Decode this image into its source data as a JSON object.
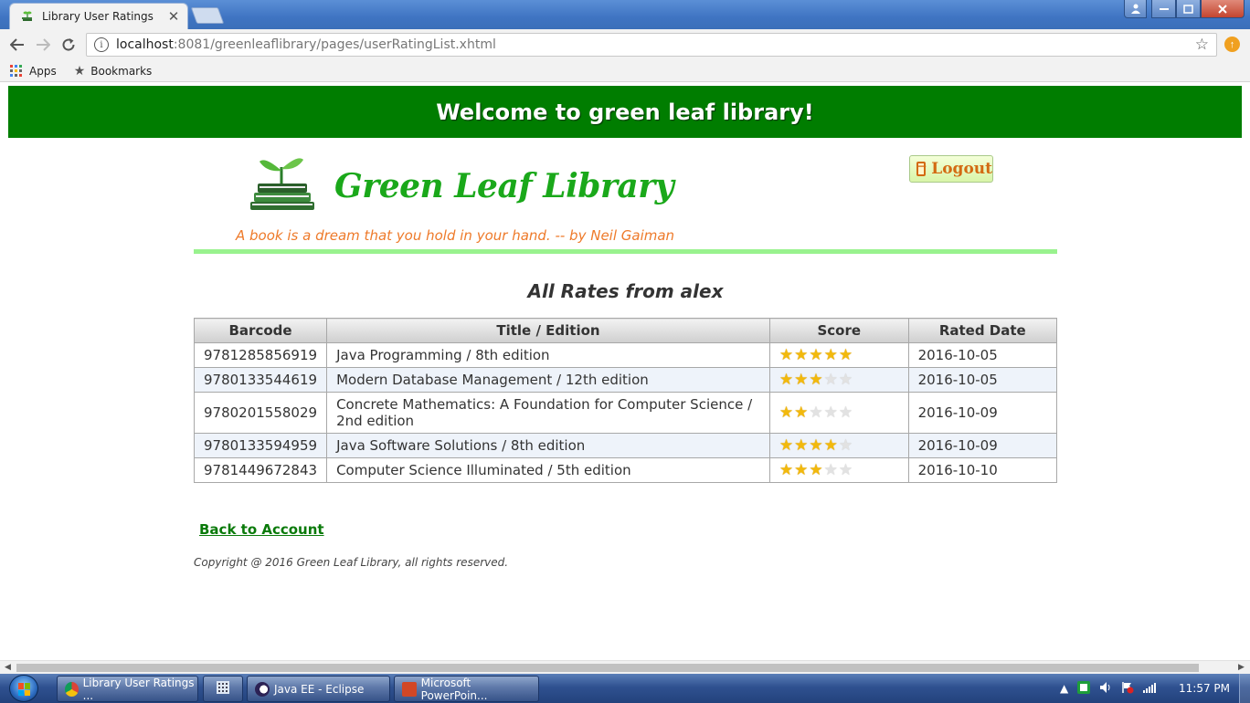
{
  "browser": {
    "tab_title": "Library User Ratings",
    "tab_close": "✕",
    "url_host": "localhost",
    "url_path": ":8081/greenleaflibrary/pages/userRatingList.xhtml",
    "bookmarks": [
      {
        "label": "Apps",
        "icon": "apps-grid-icon"
      },
      {
        "label": "Bookmarks",
        "icon": "star-icon"
      }
    ],
    "nav_icons": [
      "back-arrow-icon",
      "forward-arrow-icon",
      "reload-icon"
    ],
    "window_controls": [
      "user-icon",
      "minimize-icon",
      "maximize-icon",
      "close-icon"
    ]
  },
  "header": {
    "banner": "Welcome to green leaf library!",
    "logo_text": "Green Leaf Library",
    "tagline": "A book is a dream that you hold in your hand. -- by Neil Gaiman",
    "logout_label": "Logout"
  },
  "main": {
    "title": "All Rates from alex",
    "columns": [
      "Barcode",
      "Title / Edition",
      "Score",
      "Rated Date"
    ],
    "rows": [
      {
        "barcode": "9781285856919",
        "title": "Java Programming / 8th edition",
        "score": 5,
        "date": "2016-10-05"
      },
      {
        "barcode": "9780133544619",
        "title": "Modern Database Management / 12th edition",
        "score": 3,
        "date": "2016-10-05"
      },
      {
        "barcode": "9780201558029",
        "title": "Concrete Mathematics: A Foundation for Computer Science / 2nd edition",
        "score": 2,
        "date": "2016-10-09"
      },
      {
        "barcode": "9780133594959",
        "title": "Java Software Solutions / 8th edition",
        "score": 4,
        "date": "2016-10-09"
      },
      {
        "barcode": "9781449672843",
        "title": "Computer Science Illuminated / 5th edition",
        "score": 3,
        "date": "2016-10-10"
      }
    ],
    "max_score": 5,
    "back_link": "Back to Account",
    "copyright": "Copyright @ 2016 Green Leaf Library, all rights reserved."
  },
  "taskbar": {
    "items": [
      {
        "label": "Library User Ratings ...",
        "icon": "chrome-icon"
      },
      {
        "label": "",
        "icon": "calculator-grid-icon"
      },
      {
        "label": "Java EE - Eclipse",
        "icon": "eclipse-icon"
      },
      {
        "label": "Microsoft PowerPoin...",
        "icon": "powerpoint-icon"
      }
    ],
    "clock": "11:57 PM"
  },
  "colors": {
    "banner_bg": "#007d00",
    "logo_green": "#1aa81a",
    "tagline_orange": "#ee7a2a",
    "rule_green": "#99f28e",
    "star_gold": "#f2b90c",
    "link_green": "#0a7a0a"
  }
}
